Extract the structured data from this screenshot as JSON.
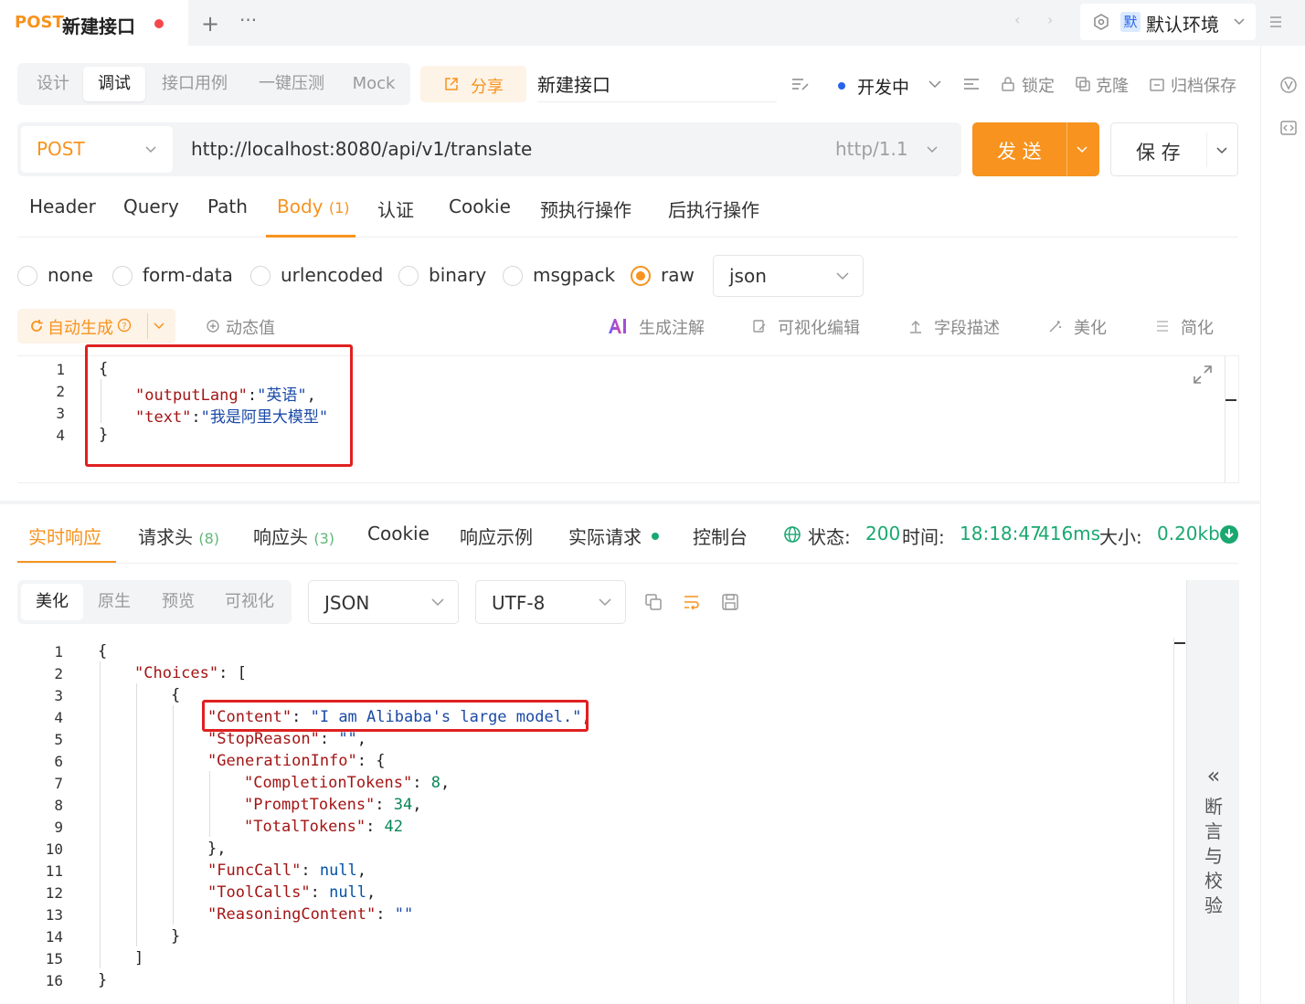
{
  "top_tab": {
    "method": "POST",
    "name": "新建接口"
  },
  "env": {
    "mark": "默",
    "name": "默认环境"
  },
  "mode_tabs": [
    "设计",
    "调试",
    "接口用例",
    "一键压测",
    "Mock"
  ],
  "share_label": "分享",
  "api_title": "新建接口",
  "toolbar": {
    "status": "开发中",
    "lock": "锁定",
    "clone": "克隆",
    "archive": "归档保存"
  },
  "request": {
    "method": "POST",
    "url": "http://localhost:8080/api/v1/translate",
    "http_version": "http/1.1",
    "send_label": "发 送",
    "save_label": "保 存"
  },
  "req_tabs": [
    {
      "label": "Header",
      "count": ""
    },
    {
      "label": "Query",
      "count": ""
    },
    {
      "label": "Path",
      "count": ""
    },
    {
      "label": "Body",
      "count": "(1)"
    },
    {
      "label": "认证",
      "count": ""
    },
    {
      "label": "Cookie",
      "count": ""
    },
    {
      "label": "预执行操作",
      "count": ""
    },
    {
      "label": "后执行操作",
      "count": ""
    }
  ],
  "body_types": [
    "none",
    "form-data",
    "urlencoded",
    "binary",
    "msgpack",
    "raw"
  ],
  "body_format": "json",
  "body_toolbar": {
    "auto_gen": "自动生成",
    "dynamic": "动态值",
    "ai_comment": "生成注解",
    "visual_edit": "可视化编辑",
    "field_desc": "字段描述",
    "beautify": "美化",
    "simplify": "简化"
  },
  "request_body_lines": [
    {
      "n": "1",
      "indent": 0,
      "parts": [
        [
          "pun",
          "{"
        ]
      ]
    },
    {
      "n": "2",
      "indent": 1,
      "parts": [
        [
          "key",
          "\"outputLang\""
        ],
        [
          "pun",
          ":"
        ],
        [
          "str",
          "\"英语\""
        ],
        [
          "pun",
          ","
        ]
      ]
    },
    {
      "n": "3",
      "indent": 1,
      "parts": [
        [
          "key",
          "\"text\""
        ],
        [
          "pun",
          ":"
        ],
        [
          "str",
          "\"我是阿里大模型\""
        ]
      ]
    },
    {
      "n": "4",
      "indent": 0,
      "parts": [
        [
          "pun",
          "}"
        ]
      ]
    }
  ],
  "resp_tabs": [
    {
      "label": "实时响应",
      "count": ""
    },
    {
      "label": "请求头",
      "count": "(8)"
    },
    {
      "label": "响应头",
      "count": "(3)"
    },
    {
      "label": "Cookie",
      "count": ""
    },
    {
      "label": "响应示例",
      "count": ""
    },
    {
      "label": "实际请求",
      "count": ""
    },
    {
      "label": "控制台",
      "count": ""
    }
  ],
  "status_info": {
    "status_label": "状态:",
    "status": "200",
    "time_label": "时间:",
    "time": "18:18:47",
    "duration": "416ms",
    "size_label": "大小:",
    "size": "0.20kb"
  },
  "resp_view_tabs": [
    "美化",
    "原生",
    "预览",
    "可视化"
  ],
  "resp_format": "JSON",
  "resp_encoding": "UTF-8",
  "assert_panel": {
    "chevron": "«",
    "chars": [
      "断",
      "言",
      "与",
      "校",
      "验"
    ]
  },
  "response_lines": [
    {
      "n": "1",
      "indent": 0,
      "parts": [
        [
          "pun",
          "{"
        ]
      ]
    },
    {
      "n": "2",
      "indent": 1,
      "parts": [
        [
          "key",
          "\"Choices\""
        ],
        [
          "pun",
          ": ["
        ]
      ]
    },
    {
      "n": "3",
      "indent": 2,
      "parts": [
        [
          "pun",
          "{"
        ]
      ]
    },
    {
      "n": "4",
      "indent": 3,
      "parts": [
        [
          "key",
          "\"Content\""
        ],
        [
          "pun",
          ": "
        ],
        [
          "str",
          "\"I am Alibaba's large model.\""
        ],
        [
          "pun",
          ","
        ]
      ]
    },
    {
      "n": "5",
      "indent": 3,
      "parts": [
        [
          "key",
          "\"StopReason\""
        ],
        [
          "pun",
          ": "
        ],
        [
          "str",
          "\"\""
        ],
        [
          "pun",
          ","
        ]
      ]
    },
    {
      "n": "6",
      "indent": 3,
      "parts": [
        [
          "key",
          "\"GenerationInfo\""
        ],
        [
          "pun",
          ": {"
        ]
      ]
    },
    {
      "n": "7",
      "indent": 4,
      "parts": [
        [
          "key",
          "\"CompletionTokens\""
        ],
        [
          "pun",
          ": "
        ],
        [
          "num",
          "8"
        ],
        [
          "pun",
          ","
        ]
      ]
    },
    {
      "n": "8",
      "indent": 4,
      "parts": [
        [
          "key",
          "\"PromptTokens\""
        ],
        [
          "pun",
          ": "
        ],
        [
          "num",
          "34"
        ],
        [
          "pun",
          ","
        ]
      ]
    },
    {
      "n": "9",
      "indent": 4,
      "parts": [
        [
          "key",
          "\"TotalTokens\""
        ],
        [
          "pun",
          ": "
        ],
        [
          "num",
          "42"
        ]
      ]
    },
    {
      "n": "10",
      "indent": 3,
      "parts": [
        [
          "pun",
          "},"
        ]
      ]
    },
    {
      "n": "11",
      "indent": 3,
      "parts": [
        [
          "key",
          "\"FuncCall\""
        ],
        [
          "pun",
          ": "
        ],
        [
          "kw",
          "null"
        ],
        [
          "pun",
          ","
        ]
      ]
    },
    {
      "n": "12",
      "indent": 3,
      "parts": [
        [
          "key",
          "\"ToolCalls\""
        ],
        [
          "pun",
          ": "
        ],
        [
          "kw",
          "null"
        ],
        [
          "pun",
          ","
        ]
      ]
    },
    {
      "n": "13",
      "indent": 3,
      "parts": [
        [
          "key",
          "\"ReasoningContent\""
        ],
        [
          "pun",
          ": "
        ],
        [
          "str",
          "\"\""
        ]
      ]
    },
    {
      "n": "14",
      "indent": 2,
      "parts": [
        [
          "pun",
          "}"
        ]
      ]
    },
    {
      "n": "15",
      "indent": 1,
      "parts": [
        [
          "pun",
          "]"
        ]
      ]
    },
    {
      "n": "16",
      "indent": 0,
      "parts": [
        [
          "pun",
          "}"
        ]
      ]
    }
  ],
  "colors": {
    "accent": "#f7931e",
    "status_green": "#1aa870",
    "highlight_red": "#e02020",
    "active_blue": "#2563eb"
  }
}
